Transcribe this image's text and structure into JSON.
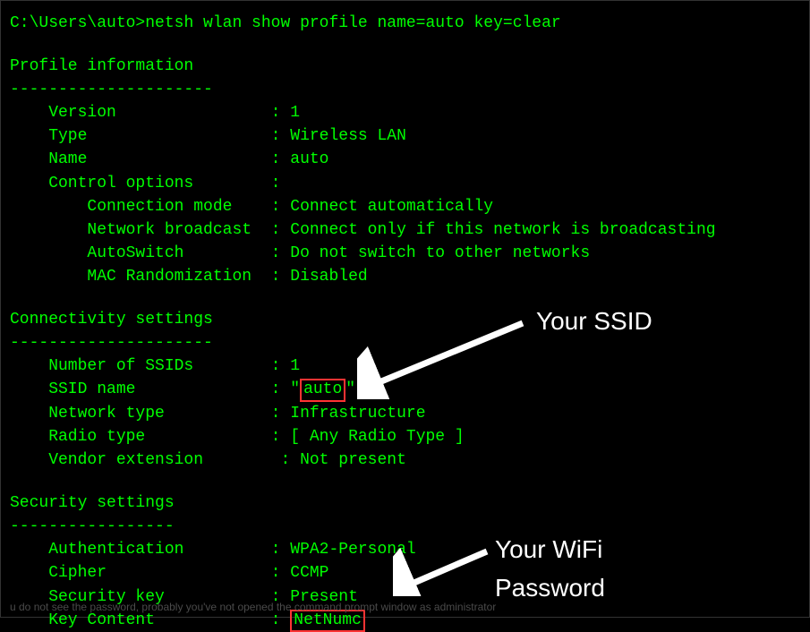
{
  "prompt": {
    "path": "C:\\Users\\auto>",
    "command": "netsh wlan show profile name=auto key=clear"
  },
  "sections": {
    "profile": {
      "title": "Profile information",
      "divider": "---------------------",
      "rows": [
        {
          "key": "    Version                ",
          "val": "1"
        },
        {
          "key": "    Type                   ",
          "val": "Wireless LAN"
        },
        {
          "key": "    Name                   ",
          "val": "auto"
        },
        {
          "key": "    Control options        ",
          "val": ""
        },
        {
          "key": "        Connection mode    ",
          "val": "Connect automatically"
        },
        {
          "key": "        Network broadcast  ",
          "val": "Connect only if this network is broadcasting"
        },
        {
          "key": "        AutoSwitch         ",
          "val": "Do not switch to other networks"
        },
        {
          "key": "        MAC Randomization  ",
          "val": "Disabled"
        }
      ]
    },
    "connectivity": {
      "title": "Connectivity settings",
      "divider": "---------------------",
      "rows": [
        {
          "key": "    Number of SSIDs        ",
          "val": "1"
        },
        {
          "key": "    SSID name              ",
          "prefixQuote": "\"",
          "highlight": "auto",
          "suffixQuote": "\""
        },
        {
          "key": "    Network type           ",
          "val": "Infrastructure"
        },
        {
          "key": "    Radio type             ",
          "val": "[ Any Radio Type ]"
        },
        {
          "key": "    Vendor extension        ",
          "val": "Not present"
        }
      ]
    },
    "security": {
      "title": "Security settings",
      "divider": "-----------------",
      "rows": [
        {
          "key": "    Authentication         ",
          "val": "WPA2-Personal"
        },
        {
          "key": "    Cipher                 ",
          "val": "CCMP"
        },
        {
          "key": "    Security key           ",
          "val": "Present"
        },
        {
          "key": "    Key Content            ",
          "highlight": "NetNumc"
        }
      ]
    }
  },
  "annotations": {
    "ssid": "Your SSID",
    "password1": "Your WiFi",
    "password2": "Password"
  },
  "footer": "u do not see the password, probably you've not opened the command prompt window as administrator"
}
